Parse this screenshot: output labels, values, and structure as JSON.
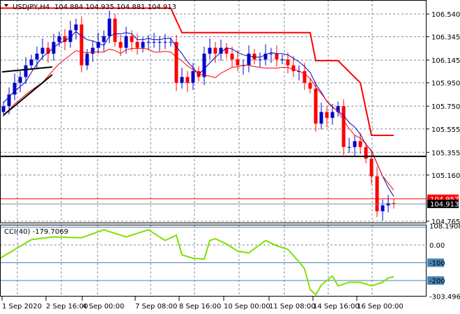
{
  "header": {
    "symbol": "USDJPY,H4",
    "ohlc_text": "104.884 104.935 104.881 104.913"
  },
  "price_axis": {
    "ticks": [
      "106.540",
      "106.345",
      "106.145",
      "105.950",
      "105.750",
      "105.555",
      "105.355",
      "105.160",
      "104.765"
    ],
    "tick_values": [
      106.54,
      106.345,
      106.145,
      105.95,
      105.75,
      105.555,
      105.355,
      105.16,
      104.765
    ],
    "bid_label": "104.957",
    "last_label": "104.913",
    "bid_value": 104.957,
    "last_value": 104.913
  },
  "cci": {
    "title": "CCI(40) -179.7069",
    "axis_labels": [
      "108.1908",
      "0.00",
      "-100",
      "-200",
      "-303.4968"
    ],
    "levels": [
      100,
      0,
      -100,
      -200
    ],
    "max": 108.1908,
    "min": -303.4968
  },
  "time_axis": [
    "1 Sep 2020",
    "2 Sep 16:00",
    "4 Sep 00:00",
    "7 Sep 08:00",
    "8 Sep 16:00",
    "10 Sep 00:00",
    "11 Sep 08:00",
    "14 Sep 16:00",
    "16 Sep 00:00"
  ],
  "colors": {
    "bull": "#0000c8",
    "bear": "#ff0000",
    "fast_ma": "#0000c8",
    "slow_ma": "#ff0000",
    "cci": "#7fe000",
    "level": "#4682b4"
  },
  "chart_data": {
    "type": "candlestick",
    "close": [
      105.75,
      105.85,
      105.95,
      106.0,
      106.1,
      106.15,
      106.2,
      106.25,
      106.2,
      106.3,
      106.35,
      106.3,
      106.4,
      106.45,
      106.1,
      106.2,
      106.25,
      106.3,
      106.35,
      106.5,
      106.3,
      106.25,
      106.35,
      106.3,
      106.25,
      106.3,
      106.3,
      106.3,
      106.3,
      106.3,
      106.3,
      105.95,
      106.0,
      105.95,
      106.05,
      106.0,
      106.2,
      106.25,
      106.2,
      106.25,
      106.2,
      106.15,
      106.1,
      106.1,
      106.2,
      106.15,
      106.15,
      106.2,
      106.2,
      106.15,
      106.15,
      106.1,
      106.05,
      106.05,
      105.95,
      105.9,
      105.6,
      105.7,
      105.65,
      105.7,
      105.75,
      105.4,
      105.4,
      105.45,
      105.4,
      105.3,
      105.15,
      104.85,
      104.9,
      104.92,
      104.913
    ],
    "channel_upper": [
      [
        0,
        106.59
      ],
      [
        30,
        106.59
      ],
      [
        32,
        106.38
      ],
      [
        55,
        106.38
      ],
      [
        56,
        106.14
      ],
      [
        60,
        106.14
      ],
      [
        64,
        105.95
      ],
      [
        66,
        105.5
      ],
      [
        70,
        105.5
      ]
    ],
    "horizontal_line": 105.32,
    "cci_points": [
      [
        0,
        -75
      ],
      [
        5,
        30
      ],
      [
        9,
        45
      ],
      [
        14,
        40
      ],
      [
        18,
        85
      ],
      [
        22,
        45
      ],
      [
        26,
        85
      ],
      [
        29,
        25
      ],
      [
        31,
        55
      ],
      [
        32,
        -55
      ],
      [
        34,
        -75
      ],
      [
        36,
        -80
      ],
      [
        37,
        25
      ],
      [
        38,
        35
      ],
      [
        40,
        5
      ],
      [
        42,
        -35
      ],
      [
        44,
        -45
      ],
      [
        47,
        25
      ],
      [
        49,
        -5
      ],
      [
        51,
        -25
      ],
      [
        53,
        -95
      ],
      [
        54,
        -135
      ],
      [
        55,
        -250
      ],
      [
        56,
        -280
      ],
      [
        57,
        -225
      ],
      [
        59,
        -175
      ],
      [
        60,
        -230
      ],
      [
        62,
        -210
      ],
      [
        64,
        -210
      ],
      [
        66,
        -230
      ],
      [
        68,
        -210
      ],
      [
        69,
        -185
      ],
      [
        70,
        -180
      ]
    ]
  }
}
